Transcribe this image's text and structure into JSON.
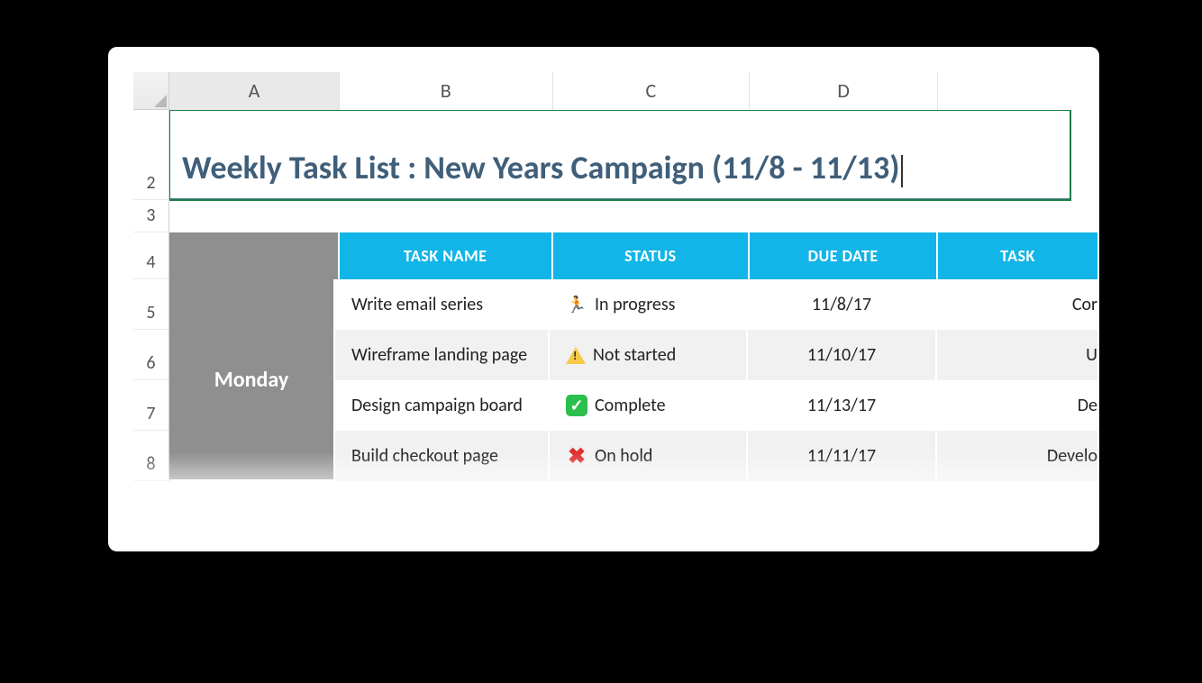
{
  "columns": [
    "A",
    "B",
    "C",
    "D",
    ""
  ],
  "row_labels": [
    "2",
    "3",
    "4",
    "5",
    "6",
    "7",
    "8"
  ],
  "title": "Weekly Task List : New Years Campaign (11/8 - 11/13)",
  "column_headers": {
    "task_name": "TASK NAME",
    "status": "STATUS",
    "due_date": "DUE DATE",
    "task_partial": "TASK"
  },
  "section_label": "Monday",
  "rows": [
    {
      "task": "Write email series",
      "status_icon": "run",
      "status": "In progress",
      "due": "11/8/17",
      "extra": "Cor"
    },
    {
      "task": "Wireframe landing page",
      "status_icon": "warn",
      "status": "Not started",
      "due": "11/10/17",
      "extra": "U"
    },
    {
      "task": "Design campaign board",
      "status_icon": "check",
      "status": "Complete",
      "due": "11/13/17",
      "extra": "De"
    },
    {
      "task": "Build checkout page",
      "status_icon": "x",
      "status": "On hold",
      "due": "11/11/17",
      "extra": "Develo"
    }
  ]
}
